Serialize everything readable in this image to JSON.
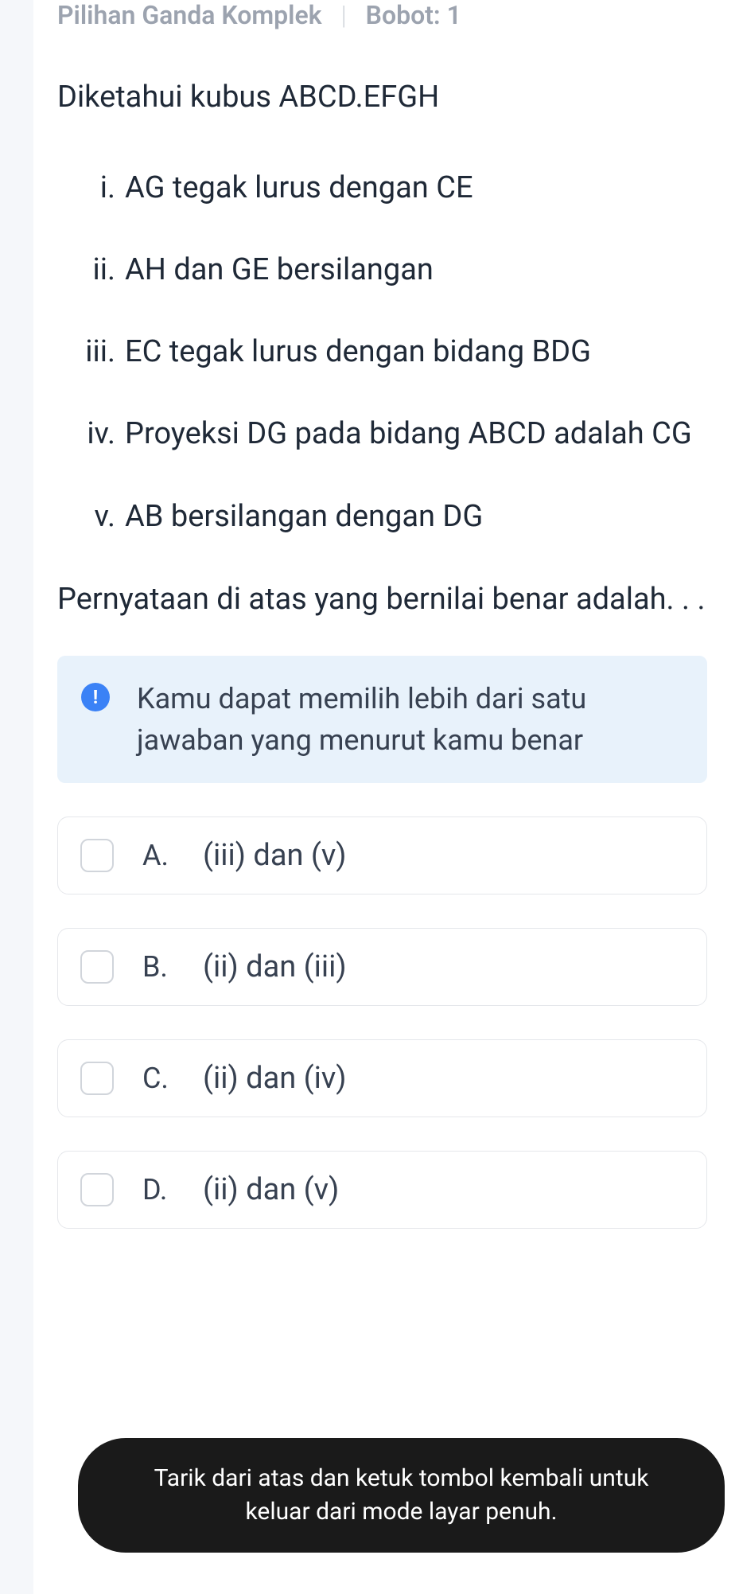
{
  "header": {
    "type_label": "Pilihan Ganda Komplek",
    "weight_label": "Bobot: 1"
  },
  "question": {
    "intro": "Diketahui kubus ABCD.EFGH",
    "items": [
      {
        "marker": "i.",
        "text": "AG tegak lurus dengan CE"
      },
      {
        "marker": "ii.",
        "text": "AH dan GE bersilangan"
      },
      {
        "marker": "iii.",
        "text": "EC tegak lurus dengan bidang BDG"
      },
      {
        "marker": "iv.",
        "text": "Proyeksi DG pada bidang ABCD adalah CG"
      },
      {
        "marker": "v.",
        "text": "AB bersilangan dengan DG"
      }
    ],
    "tail": "Pernyataan di atas yang bernilai benar adalah. . ."
  },
  "info": {
    "text": "Kamu dapat memilih lebih dari satu jawaban yang menurut kamu benar"
  },
  "options": [
    {
      "letter": "A.",
      "text": "(iii) dan (v)"
    },
    {
      "letter": "B.",
      "text": "(ii) dan (iii)"
    },
    {
      "letter": "C.",
      "text": "(ii) dan (iv)"
    },
    {
      "letter": "D.",
      "text": "(ii) dan (v)"
    }
  ],
  "toast": {
    "text": "Tarik dari atas dan ketuk tombol kembali untuk keluar dari mode layar penuh."
  }
}
